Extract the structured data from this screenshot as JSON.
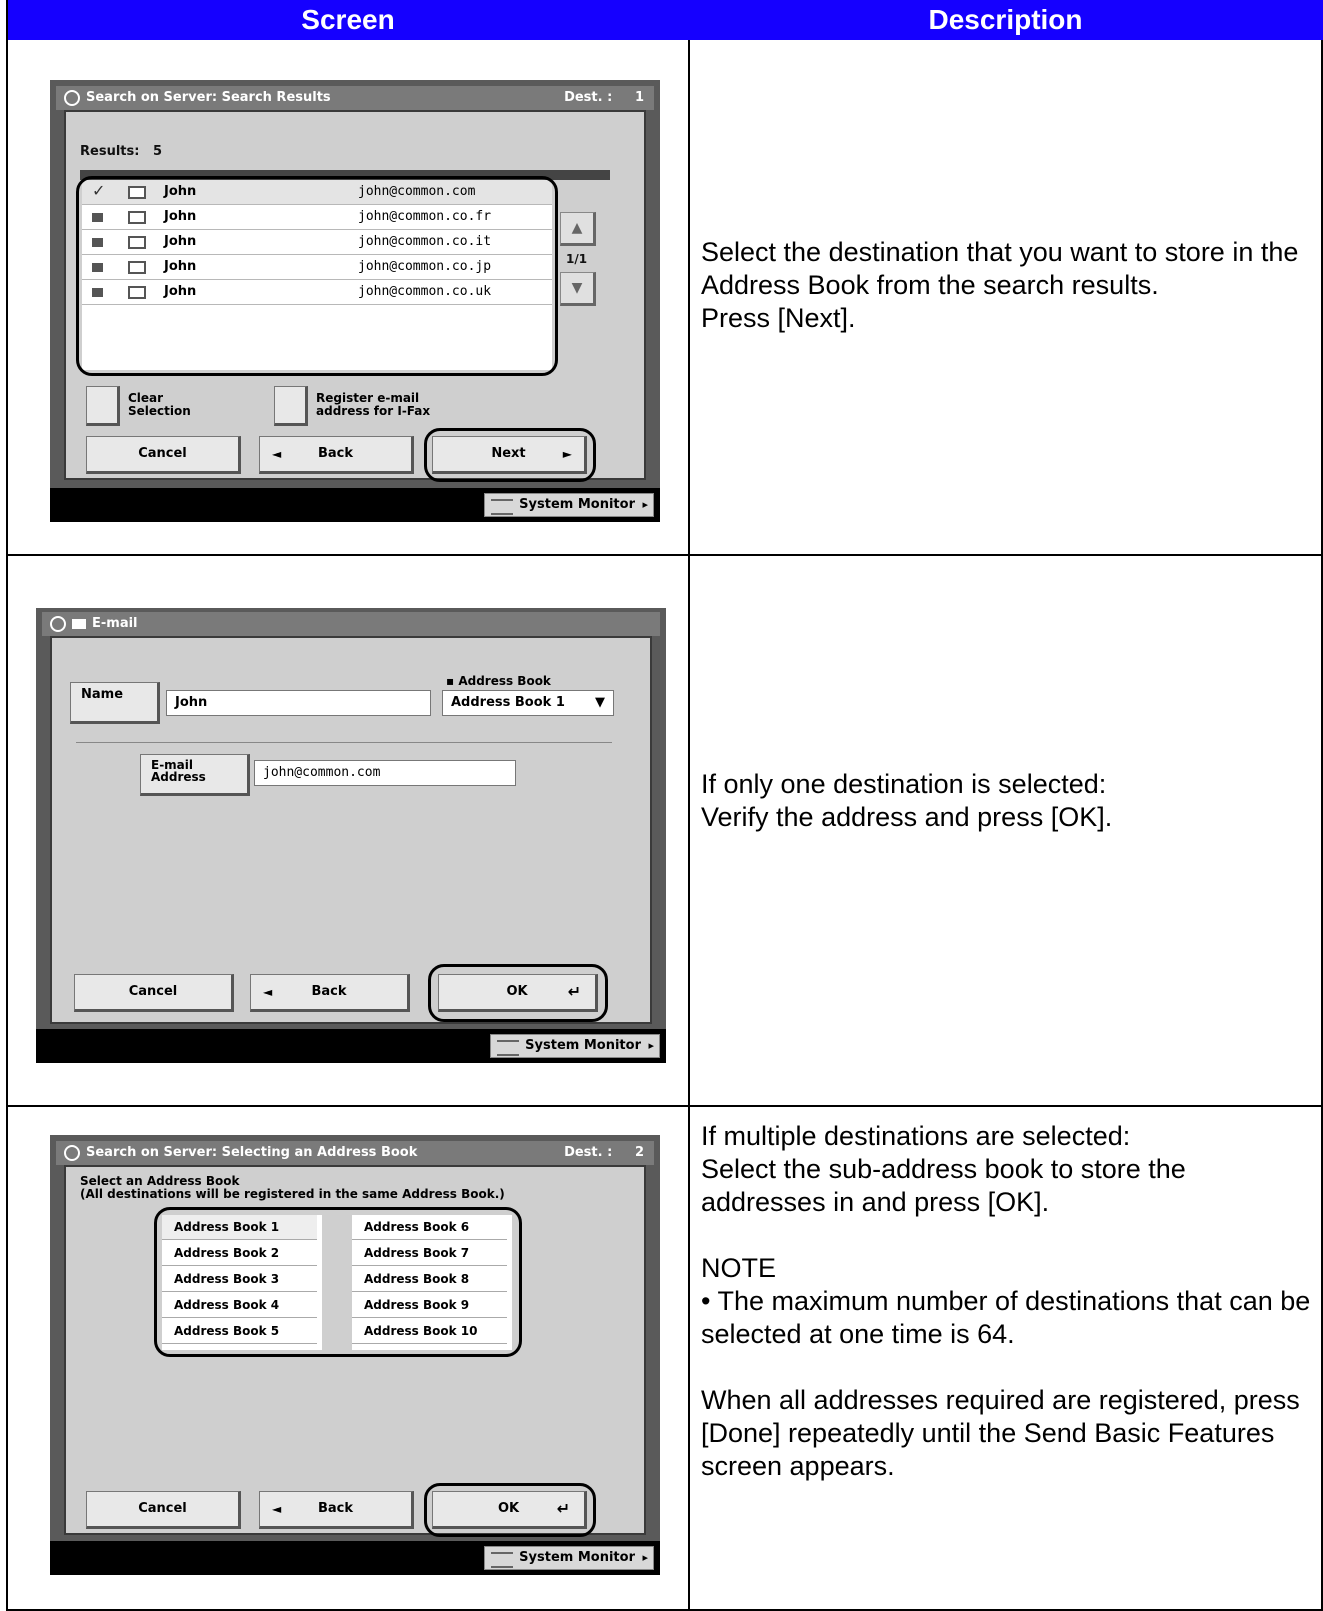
{
  "header": {
    "left": "Screen",
    "right": "Description"
  },
  "rows": [
    {
      "description": "Select the destination that you want to store in the Address Book from the search results.\n Press [Next].",
      "screen": {
        "title": "Search on Server: Search Results",
        "dest_label": "Dest. :",
        "dest_count": "1",
        "results_label": "Results:",
        "results_count": "5",
        "results": [
          {
            "name": "John",
            "email": "john@common.com"
          },
          {
            "name": "John",
            "email": "john@common.co.fr"
          },
          {
            "name": "John",
            "email": "john@common.co.it"
          },
          {
            "name": "John",
            "email": "john@common.co.jp"
          },
          {
            "name": "John",
            "email": "john@common.co.uk"
          }
        ],
        "page_indicator": "1/1",
        "clear_selection": "Clear\nSelection",
        "register_label": "Register e-mail\naddress for I-Fax",
        "cancel": "Cancel",
        "back": "Back",
        "next": "Next",
        "system_monitor": "System Monitor"
      }
    },
    {
      "description": "If only one destination is selected:\nVerify the address and press [OK].",
      "screen": {
        "title": "E-mail",
        "name_button": "Name",
        "name_value": "John",
        "address_book_label": "Address Book",
        "address_book_value": "Address Book 1",
        "email_button": "E-mail\nAddress",
        "email_value": "john@common.com",
        "cancel": "Cancel",
        "back": "Back",
        "ok": "OK",
        "system_monitor": "System Monitor"
      }
    },
    {
      "description": "If multiple destinations are selected:\nSelect the sub-address book to store the addresses in and press [OK].\n\nNOTE\n• The maximum number of destinations that can be selected at one time is 64.\n\nWhen all addresses required are registered, press [Done] repeatedly until the Send Basic Features screen appears.",
      "screen": {
        "title": "Search on Server: Selecting an Address Book",
        "dest_label": "Dest. :",
        "dest_count": "2",
        "instruction": "Select an Address Book\n(All destinations will be registered in the same Address Book.)",
        "books_left": [
          "Address Book 1",
          "Address Book 2",
          "Address Book 3",
          "Address Book 4",
          "Address Book 5"
        ],
        "books_right": [
          "Address Book 6",
          "Address Book 7",
          "Address Book 8",
          "Address Book 9",
          "Address Book 10"
        ],
        "cancel": "Cancel",
        "back": "Back",
        "ok": "OK",
        "system_monitor": "System Monitor"
      }
    }
  ]
}
